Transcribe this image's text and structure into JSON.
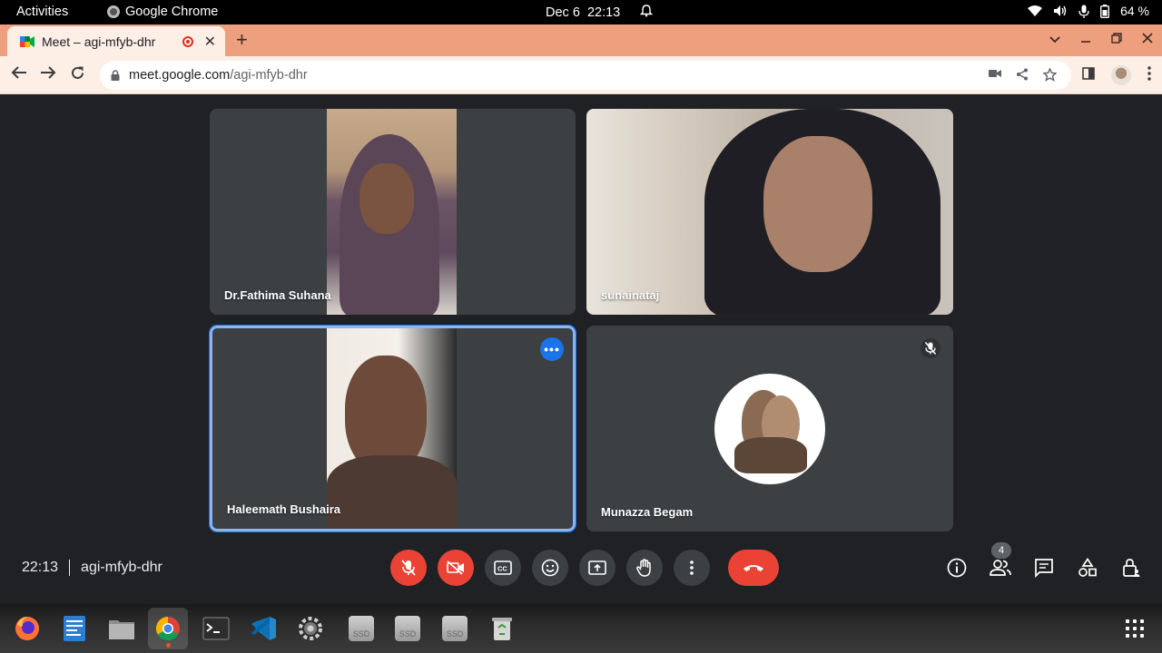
{
  "system_bar": {
    "activities": "Activities",
    "app_name": "Google Chrome",
    "date": "Dec 6",
    "time": "22:13",
    "battery": "64 %"
  },
  "browser": {
    "tab_title": "Meet – agi-mfyb-dhr",
    "url_host": "meet.google.com",
    "url_path": "/agi-mfyb-dhr"
  },
  "participants": [
    {
      "name": "Dr.Fathima Suhana",
      "muted": false,
      "camera_on": true
    },
    {
      "name": "sunainataj",
      "muted": false,
      "camera_on": true
    },
    {
      "name": "Haleemath Bushaira",
      "muted": false,
      "camera_on": true,
      "speaking": true
    },
    {
      "name": "Munazza Begam",
      "muted": true,
      "camera_on": false
    }
  ],
  "meeting": {
    "time": "22:13",
    "code": "agi-mfyb-dhr",
    "participant_count": "4"
  },
  "controls": {
    "mic": "off",
    "camera": "off"
  },
  "dock": {
    "ssd_label": "SSD"
  },
  "colors": {
    "meet_bg": "#202124",
    "tile_bg": "#3c4043",
    "red": "#ea4335",
    "tab_strip": "#ee9f7e",
    "active_border": "#8ab4f8"
  }
}
